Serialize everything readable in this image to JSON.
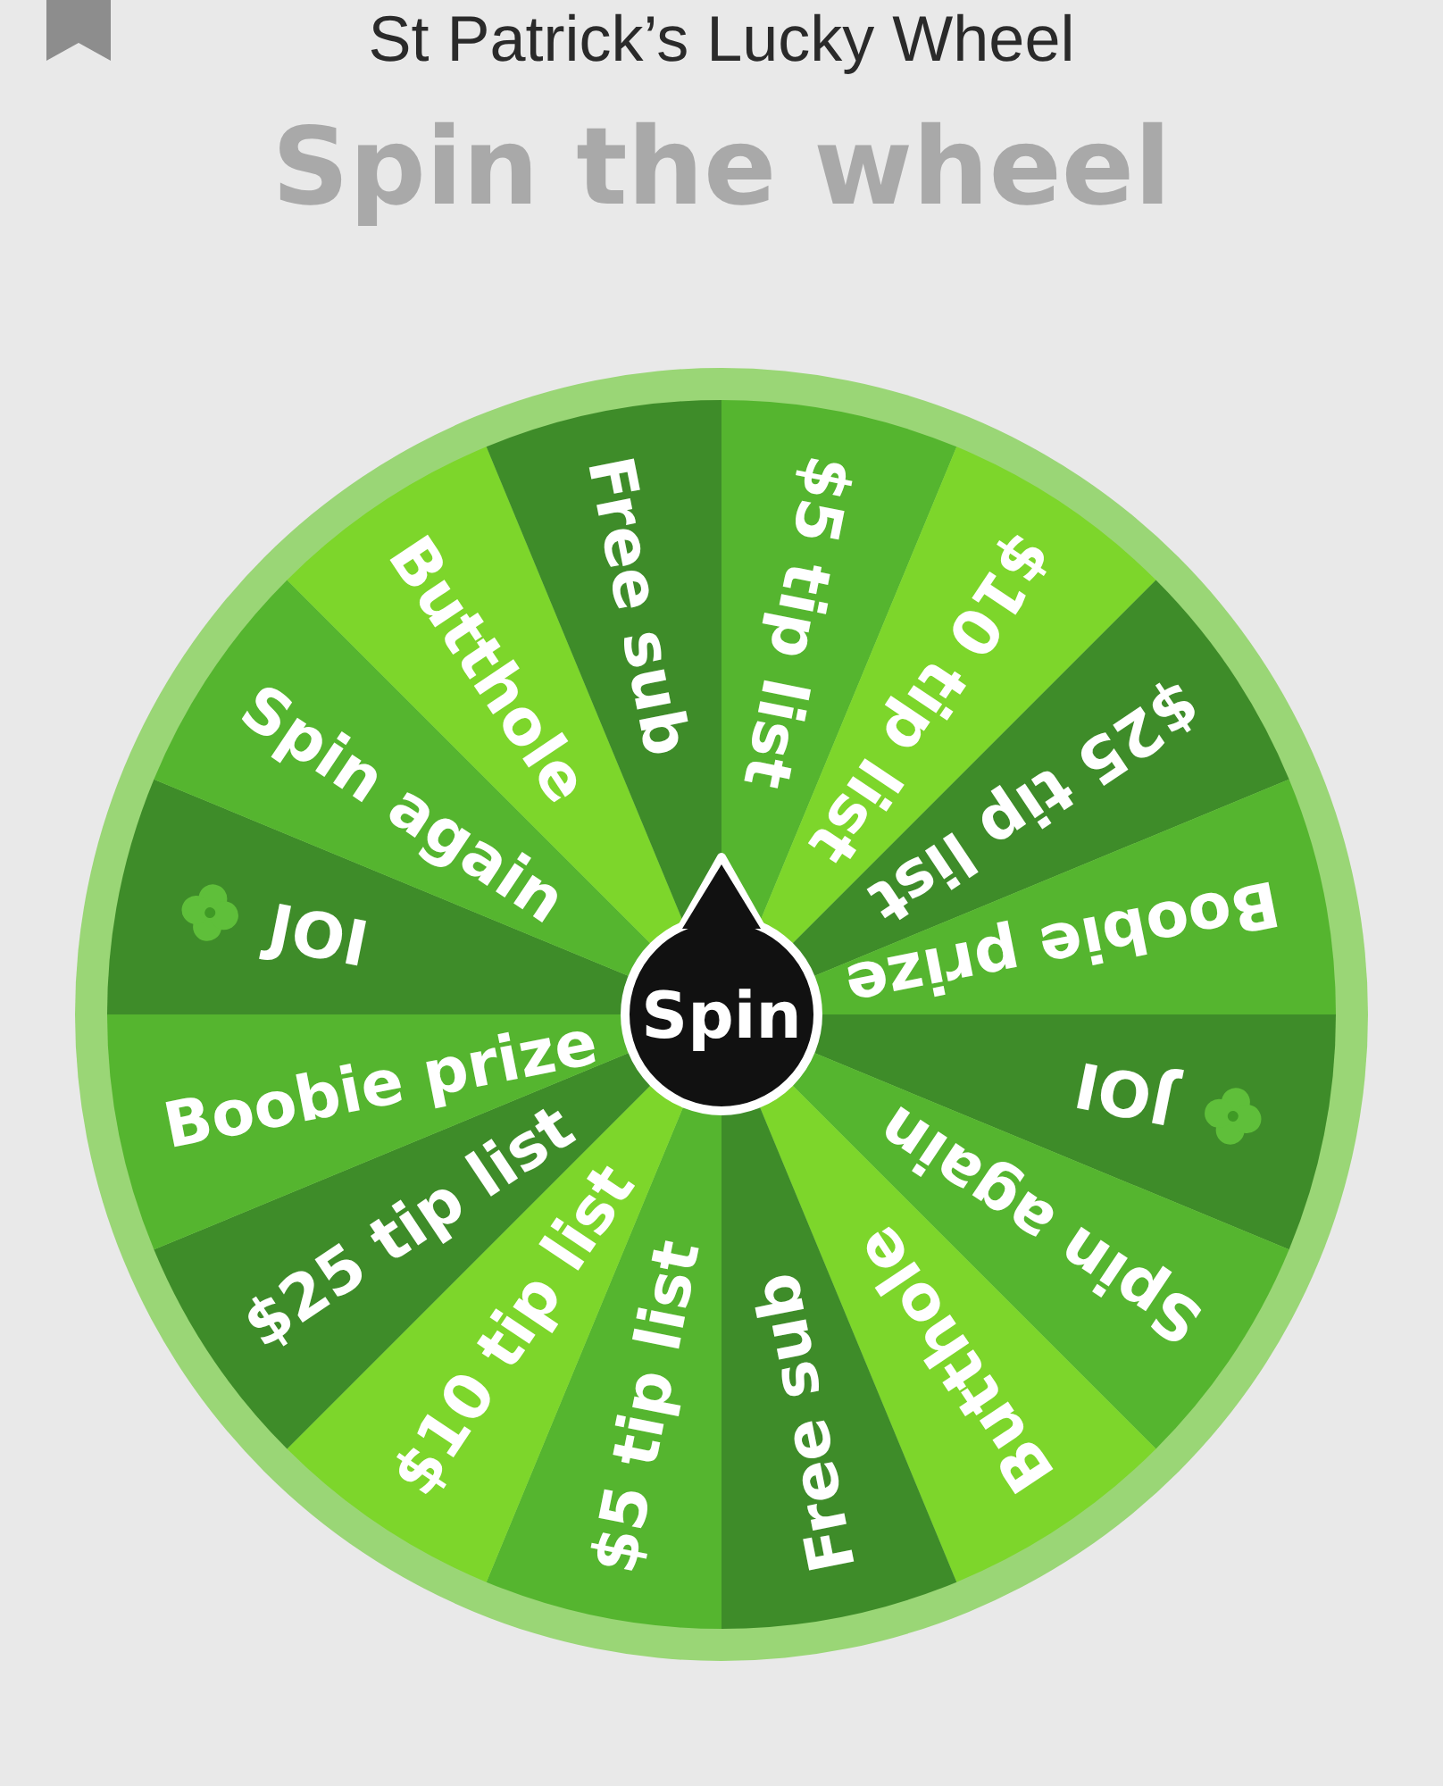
{
  "header": {
    "title": "St Patrick’s Lucky Wheel"
  },
  "heading": "Spin the wheel",
  "wheel": {
    "spin_label": "Spin",
    "segments": [
      {
        "label": "$5 tip list",
        "color": "#55b52f",
        "clover": false
      },
      {
        "label": "$10 tip list",
        "color": "#7dd62b",
        "clover": false
      },
      {
        "label": "$25 tip list",
        "color": "#3e8c29",
        "clover": false
      },
      {
        "label": "Boobie prize",
        "color": "#55b52f",
        "clover": false
      },
      {
        "label": "JOI",
        "color": "#3e8c29",
        "clover": true
      },
      {
        "label": "Spin again",
        "color": "#55b52f",
        "clover": false
      },
      {
        "label": "Butthole",
        "color": "#7dd62b",
        "clover": false
      },
      {
        "label": "Free sub",
        "color": "#3e8c29",
        "clover": false
      },
      {
        "label": "$5 tip list",
        "color": "#55b52f",
        "clover": false
      },
      {
        "label": "$10 tip list",
        "color": "#7dd62b",
        "clover": false
      },
      {
        "label": "$25 tip list",
        "color": "#3e8c29",
        "clover": false
      },
      {
        "label": "Boobie prize",
        "color": "#55b52f",
        "clover": false
      },
      {
        "label": "JOI",
        "color": "#3e8c29",
        "clover": true
      },
      {
        "label": "Spin again",
        "color": "#55b52f",
        "clover": false
      },
      {
        "label": "Butthole",
        "color": "#7dd62b",
        "clover": false
      },
      {
        "label": "Free sub",
        "color": "#3e8c29",
        "clover": false
      }
    ]
  }
}
